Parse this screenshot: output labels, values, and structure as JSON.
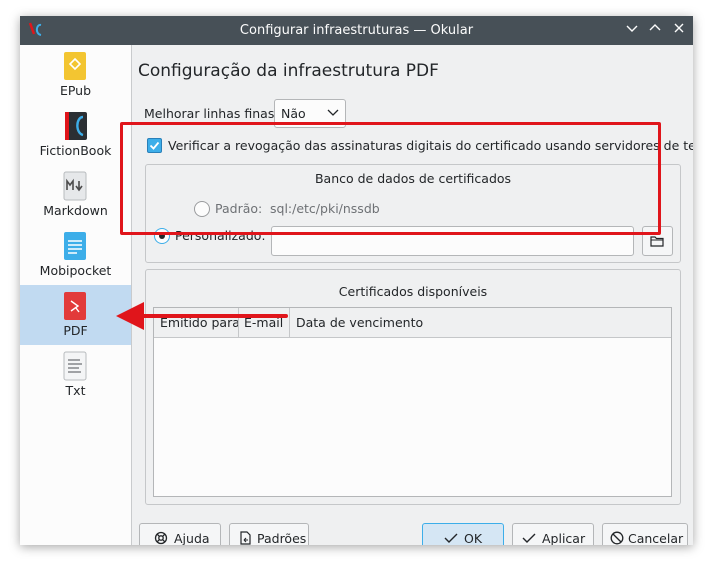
{
  "window": {
    "title": "Configurar infraestruturas — Okular"
  },
  "sidebar": {
    "items": [
      {
        "label": "EPub",
        "icon": "epub-icon"
      },
      {
        "label": "FictionBook",
        "icon": "fictionbook-icon"
      },
      {
        "label": "Markdown",
        "icon": "markdown-icon"
      },
      {
        "label": "Mobipocket",
        "icon": "mobipocket-icon"
      },
      {
        "label": "PDF",
        "icon": "pdf-icon",
        "selected": true
      },
      {
        "label": "Txt",
        "icon": "txt-icon"
      }
    ]
  },
  "page": {
    "title": "Configuração da infraestrutura PDF",
    "thin_lines_label": "Melhorar linhas finas:",
    "thin_lines_value": "Não",
    "verify_label": "Verificar a revogação das assinaturas digitais do certificado usando servidores de terceiros",
    "verify_checked": true
  },
  "cert_db": {
    "title": "Banco de dados de certificados",
    "default_label": "Padrão:",
    "default_path": "sql:/etc/pki/nssdb",
    "custom_label": "Personalizado:",
    "custom_value": "",
    "selected": "custom"
  },
  "certs": {
    "title": "Certificados disponíveis",
    "columns": [
      "Emitido para",
      "E-mail",
      "Data de vencimento"
    ],
    "rows": []
  },
  "buttons": {
    "help": "Ajuda",
    "defaults": "Padrões",
    "ok": "OK",
    "apply": "Aplicar",
    "cancel": "Cancelar"
  },
  "colors": {
    "titlebar": "#475057",
    "accent": "#3daee9",
    "highlight": "#e0151b",
    "selection": "#c1daf1"
  }
}
